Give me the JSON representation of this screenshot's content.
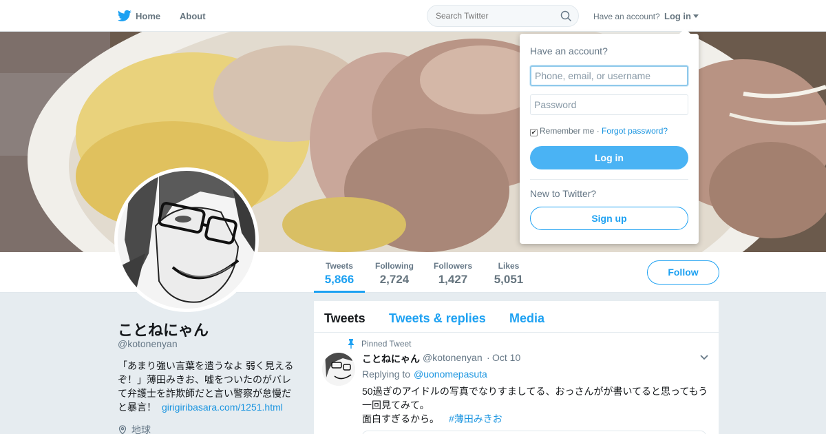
{
  "nav": {
    "home": "Home",
    "about": "About"
  },
  "search": {
    "placeholder": "Search Twitter"
  },
  "account": {
    "have_account": "Have an account?",
    "login_label": "Log in"
  },
  "stats": [
    {
      "label": "Tweets",
      "value": "5,866"
    },
    {
      "label": "Following",
      "value": "2,724"
    },
    {
      "label": "Followers",
      "value": "1,427"
    },
    {
      "label": "Likes",
      "value": "5,051"
    }
  ],
  "follow_label": "Follow",
  "profile": {
    "name": "ことねにゃん",
    "handle": "@kotonenyan",
    "bio": "「あまり強い言葉を遣うなよ 弱く見えるぞ！」薄田みきお、嘘をついたのがバレて弁護士を詐欺師だと言い警察が怠慢だと暴言！",
    "bio_link": "girigiribasara.com/1251.html",
    "location": "地球"
  },
  "tabs": [
    "Tweets",
    "Tweets & replies",
    "Media"
  ],
  "tweet": {
    "pinned_label": "Pinned Tweet",
    "name": "ことねにゃん",
    "handle": "@kotonenyan",
    "separator": "·",
    "date": "Oct 10",
    "reply_prefix": "Replying to",
    "reply_user": "@uonomepasuta",
    "text1": "50過ぎのアイドルの写真でなりすましてる、おっさんがが書いてると思ってもう一回見てみて。",
    "text2": "面白すぎるから。",
    "hashtag": "#薄田みきお"
  },
  "login_popup": {
    "title": "Have an account?",
    "username_placeholder": "Phone, email, or username",
    "password_placeholder": "Password",
    "remember": "Remember me",
    "separator": "·",
    "forgot": "Forgot password?",
    "login_button": "Log in",
    "new_label": "New to Twitter?",
    "signup_button": "Sign up"
  },
  "colors": {
    "accent": "#1da1f2",
    "login_button": "#4ab3f4",
    "link": "#1b95e0",
    "page_bg": "#e6ecf0"
  },
  "icons": [
    "twitter-bird-icon",
    "search-icon",
    "pin-icon",
    "location-icon",
    "chevron-down-icon",
    "checkbox-checked-icon"
  ]
}
